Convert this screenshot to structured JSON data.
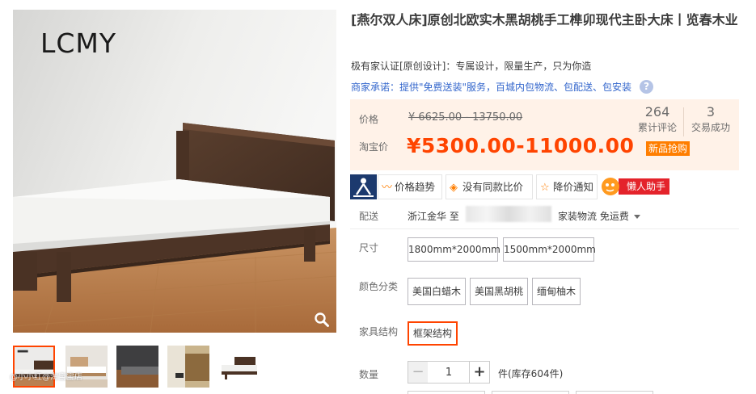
{
  "gallery": {
    "brand_logo": "LCMY",
    "watermark": "@小小红@淘宝宝店"
  },
  "product": {
    "title": "[燕尔双人床]原创北欧实木黑胡桃手工榫卯现代主卧大床丨览春木业",
    "subtitle": "极有家认证[原创设计]：专属设计，限量生产，只为你造",
    "promise_prefix": "商家承诺：",
    "promise_text": "提供\"免费送装\"服务，百城内包物流、包配送、包安装",
    "help_icon_text": "?"
  },
  "price": {
    "label_price": "价格",
    "original": "¥ 6625.00 - 13750.00",
    "label_taobao": "淘宝价",
    "taobao": "¥5300.00-11000.00",
    "promo_badge": "新品抢购",
    "reviews_count": "264",
    "reviews_label": "累计评论",
    "deals_count": "3",
    "deals_label": "交易成功",
    "accent_color": "#ff4400"
  },
  "toolbar": {
    "trend": "价格趋势",
    "compare": "没有同款比价",
    "notify": "降价通知",
    "lazy": "懒人助手"
  },
  "shipping": {
    "label": "配送",
    "from": "浙江金华 至",
    "method": "家装物流 免运费"
  },
  "size": {
    "label": "尺寸",
    "options": [
      "1800mm*2000mm",
      "1500mm*2000mm"
    ]
  },
  "color": {
    "label": "颜色分类",
    "options": [
      "美国白蜡木",
      "美国黑胡桃",
      "缅甸柚木"
    ]
  },
  "structure": {
    "label": "家具结构",
    "options": [
      "框架结构"
    ]
  },
  "quantity": {
    "label": "数量",
    "minus": "−",
    "value": "1",
    "plus": "+",
    "stock": "件(库存604件)"
  }
}
